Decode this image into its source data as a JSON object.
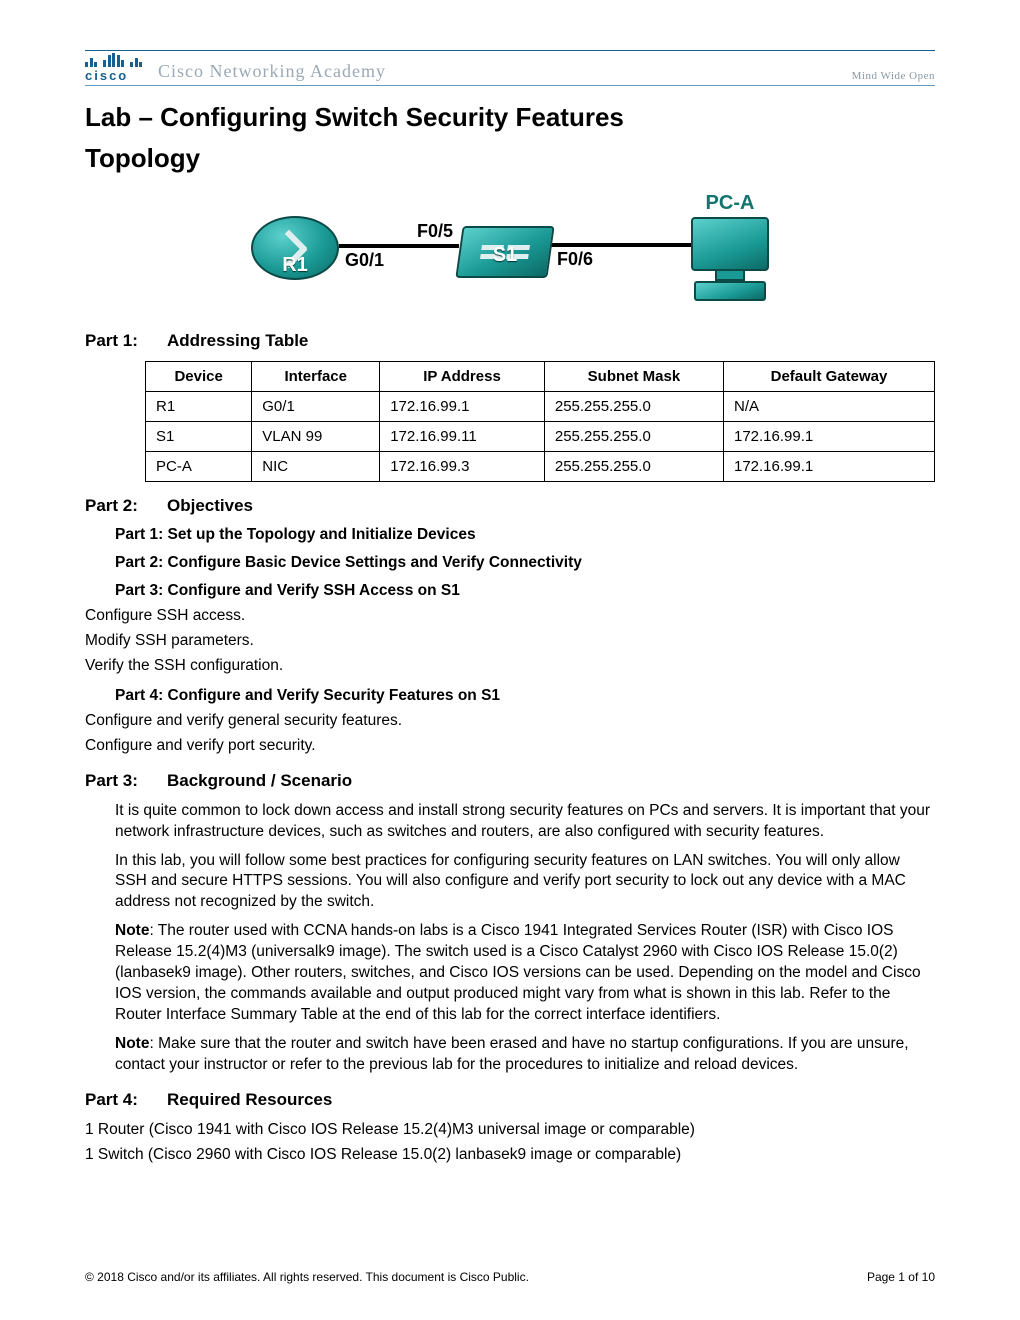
{
  "banner": {
    "brand": "cisco",
    "academy": "Cisco Networking Academy",
    "tagline": "Mind Wide Open"
  },
  "title": "Lab – Configuring Switch Security Features",
  "topology_heading": "Topology",
  "topology": {
    "r1_label": "R1",
    "s1_label": "S1",
    "pc_label": "PC-A",
    "port_g01": "G0/1",
    "port_f05": "F0/5",
    "port_f06": "F0/6"
  },
  "parts": {
    "p1": {
      "label": "Part 1:",
      "title": "Addressing Table"
    },
    "p2": {
      "label": "Part 2:",
      "title": "Objectives"
    },
    "p3": {
      "label": "Part 3:",
      "title": "Background / Scenario"
    },
    "p4": {
      "label": "Part 4:",
      "title": "Required Resources"
    }
  },
  "table": {
    "headers": [
      "Device",
      "Interface",
      "IP Address",
      "Subnet Mask",
      "Default Gateway"
    ],
    "rows": [
      [
        "R1",
        "G0/1",
        "172.16.99.1",
        "255.255.255.0",
        "N/A"
      ],
      [
        "S1",
        "VLAN 99",
        "172.16.99.11",
        "255.255.255.0",
        "172.16.99.1"
      ],
      [
        "PC-A",
        "NIC",
        "172.16.99.3",
        "255.255.255.0",
        "172.16.99.1"
      ]
    ]
  },
  "objectives": {
    "p1": "Part 1: Set up the Topology and Initialize Devices",
    "p2": "Part 2: Configure Basic Device Settings and Verify Connectivity",
    "p3": "Part 3: Configure and Verify SSH Access on S1",
    "p3_items": [
      "Configure SSH access.",
      "Modify SSH parameters.",
      "Verify the SSH configuration."
    ],
    "p4": "Part 4: Configure and Verify Security Features on S1",
    "p4_items": [
      "Configure and verify general security features.",
      "Configure and verify port security."
    ]
  },
  "background": {
    "para1": "It is quite common to lock down access and install strong security features on PCs and servers. It is important that your network infrastructure devices, such as switches and routers, are also configured with security features.",
    "para2": "In this lab, you will follow some best practices for configuring security features on LAN switches. You will only allow SSH and secure HTTPS sessions. You will also configure and verify port security to lock out any device with a MAC address not recognized by the switch.",
    "note1_label": "Note",
    "note1": ": The router used with CCNA hands-on labs is a Cisco 1941 Integrated Services Router (ISR) with Cisco IOS Release 15.2(4)M3 (universalk9 image). The switch used is a Cisco Catalyst 2960 with Cisco IOS Release 15.0(2) (lanbasek9 image). Other routers, switches, and Cisco IOS versions can be used. Depending on the model and Cisco IOS version, the commands available and output produced might vary from what is shown in this lab. Refer to the Router Interface Summary Table at the end of this lab for the correct interface identifiers.",
    "note2_label": "Note",
    "note2": ": Make sure that the router and switch have been erased and have no startup configurations. If you are unsure, contact your instructor or refer to the previous lab for the procedures to initialize and reload devices."
  },
  "resources": [
    "1 Router (Cisco 1941 with Cisco IOS Release 15.2(4)M3 universal image or comparable)",
    "1 Switch (Cisco 2960 with Cisco IOS Release 15.0(2) lanbasek9 image or comparable)"
  ],
  "footer": {
    "copyright": "© 2018 Cisco and/or its affiliates. All rights reserved. This document is Cisco Public.",
    "page": "Page 1 of 10"
  }
}
